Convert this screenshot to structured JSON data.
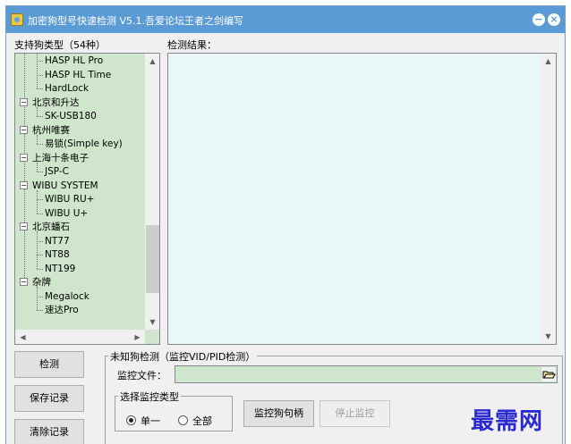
{
  "window": {
    "title": "加密狗型号快速检测 V5.1.吾爱论坛王者之剑编写",
    "minimize_label": "−",
    "close_label": "×"
  },
  "left_panel": {
    "label": "支持狗类型（54种）",
    "tree": [
      {
        "text": "HASP HL Pro",
        "level": 1
      },
      {
        "text": "HASP HL Time",
        "level": 1
      },
      {
        "text": "HardLock",
        "level": 1
      },
      {
        "text": "北京和升达",
        "level": 0
      },
      {
        "text": "SK-USB180",
        "level": 1
      },
      {
        "text": "杭州唯赛",
        "level": 0
      },
      {
        "text": "易锁(Simple key)",
        "level": 1
      },
      {
        "text": "上海十条电子",
        "level": 0
      },
      {
        "text": "JSP-C",
        "level": 1
      },
      {
        "text": "WIBU SYSTEM",
        "level": 0
      },
      {
        "text": "WIBU RU+",
        "level": 1
      },
      {
        "text": "WIBU U+",
        "level": 1
      },
      {
        "text": "北京蟠石",
        "level": 0
      },
      {
        "text": "NT77",
        "level": 1
      },
      {
        "text": "NT88",
        "level": 1
      },
      {
        "text": "NT199",
        "level": 1
      },
      {
        "text": "杂牌",
        "level": 0
      },
      {
        "text": "Megalock",
        "level": 1
      },
      {
        "text": "速达Pro",
        "level": 1
      }
    ],
    "toggle_symbol": "−",
    "scroll_position": 0.88
  },
  "right_panel": {
    "label": "检测结果："
  },
  "buttons": {
    "detect": "检测",
    "save": "保存记录",
    "clear": "清除记录",
    "monitor_handle": "监控狗句柄",
    "stop_monitor": "停止监控"
  },
  "unknown_dog": {
    "group_title": "未知狗检测（监控VID/PID检测）",
    "file_label": "监控文件：",
    "file_value": "",
    "monitor_type_title": "选择监控类型",
    "options": [
      {
        "label": "单一",
        "checked": true
      },
      {
        "label": "全部",
        "checked": false
      }
    ]
  },
  "watermark": "最需网",
  "colors": {
    "titlebar": "#5b9bd5",
    "tree_bg": "#cfe6cc",
    "result_bg": "#eaf7f7",
    "watermark": "#2a2ad0"
  },
  "icons": {
    "app": "app-icon",
    "folder_open": "folder-open-icon",
    "scroll_up": "scroll-up-icon",
    "scroll_down": "scroll-down-icon",
    "scroll_left": "scroll-left-icon",
    "scroll_right": "scroll-right-icon"
  }
}
